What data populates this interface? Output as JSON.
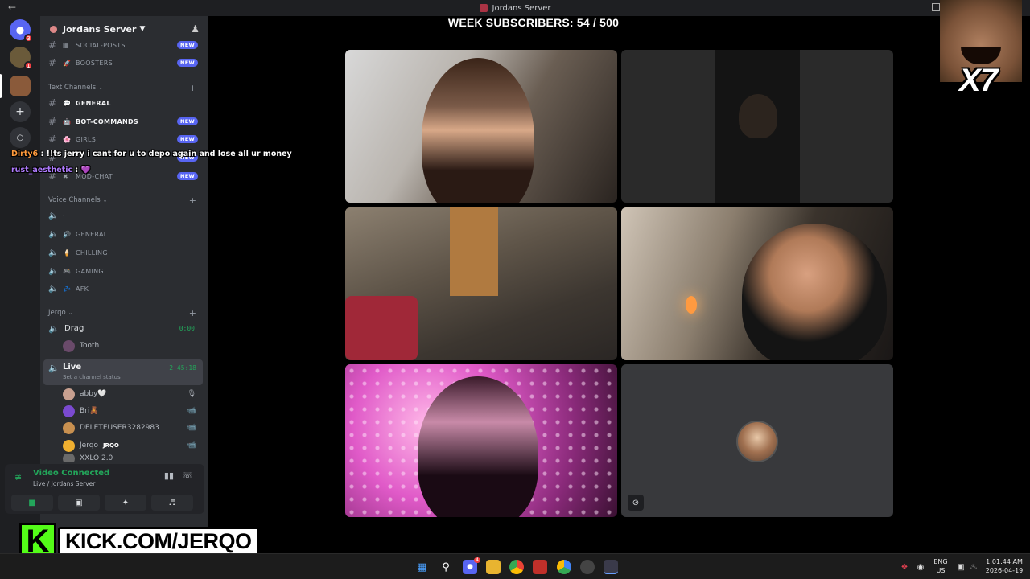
{
  "window": {
    "title": "Jordans Server"
  },
  "rail": {
    "badges": [
      "3",
      "1"
    ]
  },
  "server": {
    "name": "Jordans Server"
  },
  "channels_top": [
    {
      "name": "SOCIAL-POSTS",
      "emoji": "▦",
      "new_label": "NEW"
    },
    {
      "name": "BOOSTERS",
      "emoji": "🚀",
      "new_label": "NEW"
    }
  ],
  "text_category": "Text Channels",
  "text_channels": [
    {
      "name": "GENERAL",
      "emoji": "💬",
      "new_label": ""
    },
    {
      "name": "BOT-COMMANDS",
      "emoji": "🤖",
      "new_label": "NEW"
    },
    {
      "name": "GIRLS",
      "emoji": "🌸",
      "new_label": "NEW"
    },
    {
      "name": "",
      "emoji": "",
      "new_label": "NEW"
    },
    {
      "name": "MOD-CHAT",
      "emoji": "✖",
      "new_label": "NEW"
    }
  ],
  "voice_category": "Voice Channels",
  "voice_channels": [
    {
      "name": "",
      "emoji": "·"
    },
    {
      "name": "GENERAL",
      "emoji": "🔊"
    },
    {
      "name": "CHILLING",
      "emoji": "🍦"
    },
    {
      "name": "GAMING",
      "emoji": "🎮"
    },
    {
      "name": "AFK",
      "emoji": "💤"
    }
  ],
  "jerqo_category": "Jerqo",
  "drag": {
    "name": "Drag",
    "time": "0:00",
    "member": "Tooth"
  },
  "live": {
    "name": "Live",
    "status": "Set a channel status",
    "time": "2:45:18"
  },
  "members": [
    {
      "name": "abby🤍",
      "color": "#c8a090",
      "icon": "🎙"
    },
    {
      "name": "Bri🧸",
      "color": "#7a4ad0",
      "icon": "📹"
    },
    {
      "name": "DELETEUSER3282983",
      "color": "#c89050",
      "icon": "📹"
    },
    {
      "name": "Jerqo",
      "tag": "JRQO",
      "color": "#f0b030",
      "icon": "📹"
    },
    {
      "name": "XXLO 2.0",
      "color": "#6a6a6a",
      "icon": "📹"
    }
  ],
  "voice_panel": {
    "title": "Video Connected",
    "subtitle": "Live / Jordans Server"
  },
  "chat": [
    {
      "user": "Dirty6",
      "user_color": "#ff9a3c",
      "message": "!!ts jerry i cant for u to depo again and lose all ur money"
    },
    {
      "user": "rust_aesthetic",
      "user_color": "#b07cff",
      "message": "💜"
    }
  ],
  "stage_title": "WEEK SUBSCRIBERS: 54 / 500",
  "emote_text": "X7",
  "kick": {
    "logo": "K",
    "url": "KICK.COM/JERQO"
  },
  "taskbar": {
    "lang": "ENG",
    "region": "US",
    "time": "1:01:44 AM",
    "date": "2026-04-19",
    "discord_badge": "4"
  },
  "colors": {
    "accent": "#5865f2",
    "online": "#23a55a",
    "kick_green": "#53fc18"
  }
}
